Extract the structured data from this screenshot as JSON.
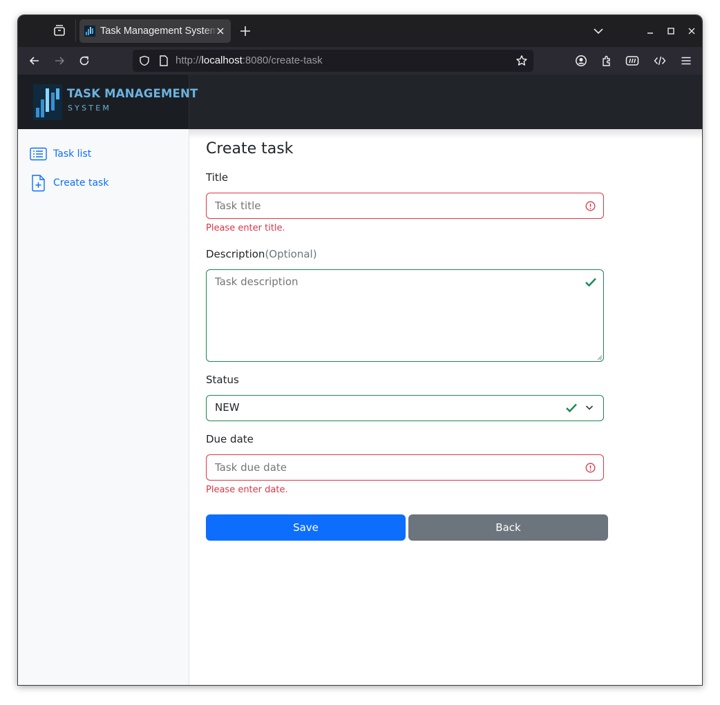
{
  "browser": {
    "tab_title": "Task Management System",
    "url_scheme": "http://",
    "url_host": "localhost",
    "url_rest": ":8080/create-task"
  },
  "app": {
    "logo_title": "TASK MANAGEMENT",
    "logo_subtitle": "SYSTEM",
    "colors": {
      "primary": "#0d6efd",
      "secondary": "#6c757d",
      "danger": "#dc3545",
      "success": "#198754",
      "header": "#212529"
    }
  },
  "sidebar": {
    "items": [
      {
        "label": "Task list",
        "icon": "list-icon"
      },
      {
        "label": "Create task",
        "icon": "file-plus-icon"
      }
    ]
  },
  "form": {
    "heading": "Create task",
    "title": {
      "label": "Title",
      "placeholder": "Task title",
      "error": "Please enter title."
    },
    "description": {
      "label": "Description",
      "optional": "(Optional)",
      "placeholder": "Task description"
    },
    "status": {
      "label": "Status",
      "value": "NEW"
    },
    "due_date": {
      "label": "Due date",
      "placeholder": "Task due date",
      "error": "Please enter date."
    },
    "save_label": "Save",
    "back_label": "Back"
  }
}
